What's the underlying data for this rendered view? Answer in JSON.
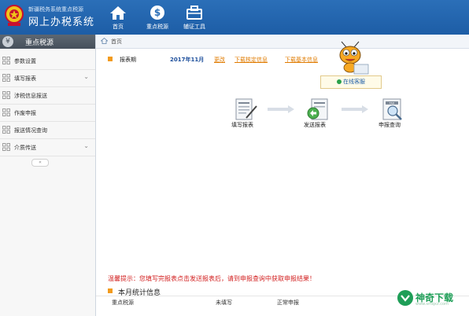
{
  "header": {
    "logo_small": "新疆税务系统重点税源",
    "logo_big": "网上办税系统",
    "nav": [
      {
        "label": "首页",
        "icon": "home-icon"
      },
      {
        "label": "重点税源",
        "icon": "yuan-coin-icon"
      },
      {
        "label": "辅证工具",
        "icon": "toolbox-icon"
      }
    ],
    "colors": {
      "bar": "#1d5da6",
      "text": "#ffffff"
    }
  },
  "sidebar": {
    "title": "重点税源",
    "items": [
      {
        "label": "参数设置",
        "expandable": false
      },
      {
        "label": "填写报表",
        "expandable": true
      },
      {
        "label": "涉税信息报送",
        "expandable": false
      },
      {
        "label": "作废申报",
        "expandable": false
      },
      {
        "label": "报送情况查询",
        "expandable": false
      },
      {
        "label": "介质传送",
        "expandable": true
      }
    ],
    "collapse_symbol": "«"
  },
  "breadcrumb": {
    "text": "首页"
  },
  "period": {
    "label": "报表期",
    "value": "2017年11月",
    "links": [
      "更改",
      "下载核定信息",
      "下载基本信息"
    ]
  },
  "online_service": {
    "label": "在线客服"
  },
  "flow": {
    "steps": [
      {
        "label": "填写报表",
        "icon": "fill-report-icon"
      },
      {
        "label": "发送报表",
        "icon": "send-report-icon"
      },
      {
        "label": "申报查询",
        "icon": "query-report-icon"
      }
    ]
  },
  "tip": "温馨提示：您填写完报表点击发送报表后，请到申报查询中获取申报结果！",
  "stats": {
    "title": "本月统计信息",
    "columns": [
      "重点税源",
      "未填写",
      "正常申报"
    ]
  },
  "watermark": {
    "text": "神奇下载",
    "url": "www.smqxz.com"
  },
  "accent_colors": {
    "orange": "#f29b1d",
    "tip_red": "#d21f1f",
    "link_orange": "#e07b00"
  }
}
